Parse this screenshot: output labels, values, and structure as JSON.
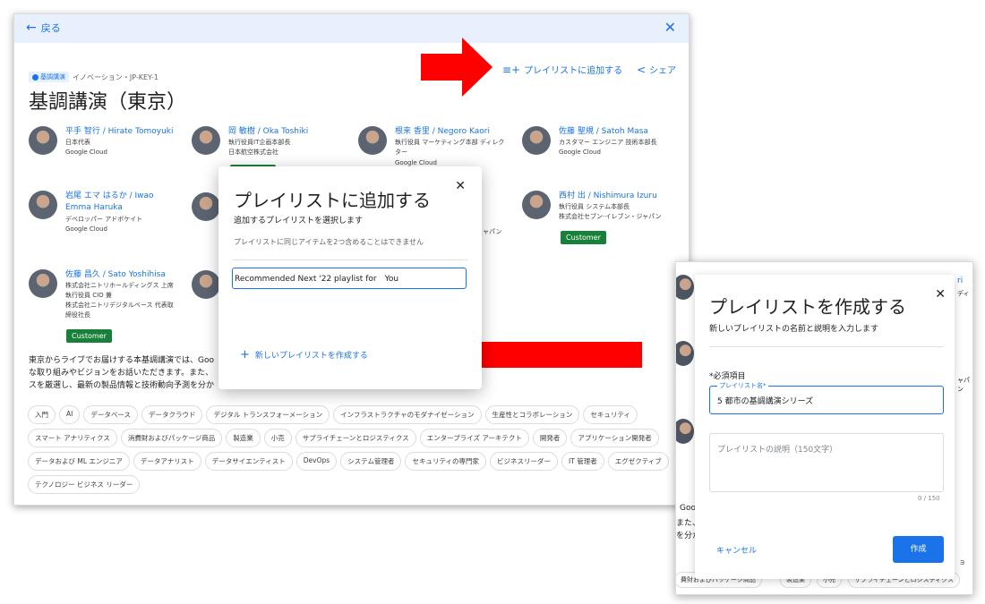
{
  "topbar": {
    "back_label": "戻る",
    "back_icon": "arrow-left-icon",
    "close_glyph": "✕"
  },
  "actions": {
    "add_to_playlist": "プレイリストに追加する",
    "share": "シェア"
  },
  "meta": {
    "category_chip": "基調講演",
    "path": "イノベーション・JP-KEY-1"
  },
  "title": "基調講演（東京）",
  "speakers": [
    {
      "name": "平手 智行 / Hirate Tomoyuki",
      "lines": [
        "日本代表",
        "Google Cloud"
      ]
    },
    {
      "name": "岡 敏樹 / Oka Toshiki",
      "lines": [
        "執行役員IT企画本部長",
        "日本航空株式会社"
      ]
    },
    {
      "name": "根来 香里 / Negoro Kaori",
      "lines": [
        "執行役員 マーケティング本部 ディレク",
        "ター",
        "Google Cloud"
      ]
    },
    {
      "name": "佐藤 聖規 / Satoh Masa",
      "lines": [
        "カスタマー エンジニア 技術本部長",
        "Google Cloud"
      ]
    },
    {
      "name": "岩尾 エマ はるか / Iwao",
      "name2": "Emma Haruka",
      "lines": [
        "デベロッパー アドボケイト",
        "Google Cloud"
      ]
    },
    {
      "name": "西村 出 / Nishimura Izuru",
      "lines": [
        "執行役員 システム本部長",
        "株式会社セブン-イレブン・ジャパン"
      ]
    },
    {
      "name": "佐藤 昌久 / Sato Yoshihisa",
      "lines": [
        "株式会社ニトリホールディングス 上席",
        "執行役員 CIO 兼",
        "株式会社ニトリデジタルベース 代表取",
        "締役社長"
      ]
    }
  ],
  "badges": {
    "customer": "Customer"
  },
  "fragments": {
    "japan": "ャパン"
  },
  "description": [
    "東京からライブでお届けする本基調講演では、Goo",
    "な取り組みやビジョンをお話いただきます。また、",
    "スを厳選し、最新の製品情報と技術動向予測を分か"
  ],
  "tags": [
    "入門",
    "AI",
    "データベース",
    "データクラウド",
    "デジタル トランスフォーメーション",
    "インフラストラクチャのモダナイゼーション",
    "生産性とコラボレーション",
    "セキュリティ",
    "スマート アナリティクス",
    "消費財およびパッケージ商品",
    "製造業",
    "小売",
    "サプライチェーンとロジスティクス",
    "エンタープライズ アーキテクト",
    "開発者",
    "アプリケーション開発者",
    "データおよび ML エンジニア",
    "データアナリスト",
    "データサイエンティスト",
    "DevOps",
    "システム管理者",
    "セキュリティの専門家",
    "ビジネスリーダー",
    "IT 管理者",
    "エグゼクティブ",
    "テクノロジー ビジネス リーダー"
  ],
  "dialog_add": {
    "title": "プレイリストに追加する",
    "subtitle": "追加するプレイリストを選択します",
    "note": "プレイリストに同じアイテムを2つ含めることはできません",
    "selected_playlist": "Recommended Next '22 playlist for　You",
    "new_playlist": "新しいプレイリストを作成する"
  },
  "dialog_create": {
    "title": "プレイリストを作成する",
    "subtitle": "新しいプレイリストの名前と説明を入力します",
    "required": "*必須項目",
    "name_label": "プレイリスト名*",
    "name_value": "5 都市の基調講演シリーズ",
    "desc_placeholder": "プレイリストの説明（150文字）",
    "char_count": "0 / 150",
    "cancel": "キャンセル",
    "create": "作成"
  },
  "bg2": {
    "frag_ri": "ri",
    "frag_di": "ディ",
    "frag_pan": "ャパン",
    "frag_goo": "Goo",
    "frag_mata": "また、",
    "frag_wo": "を分か",
    "tag_frag1": "費財およびパッケージ商品",
    "tag_frag2": "製造業",
    "tag_frag3": "小売",
    "tag_frag4": "サプライチェーンとロジスティクス",
    "tag_frag5": "ョ"
  },
  "colors": {
    "accent": "#1a73e8",
    "customer_badge": "#188038",
    "arrow": "#ff0000"
  }
}
